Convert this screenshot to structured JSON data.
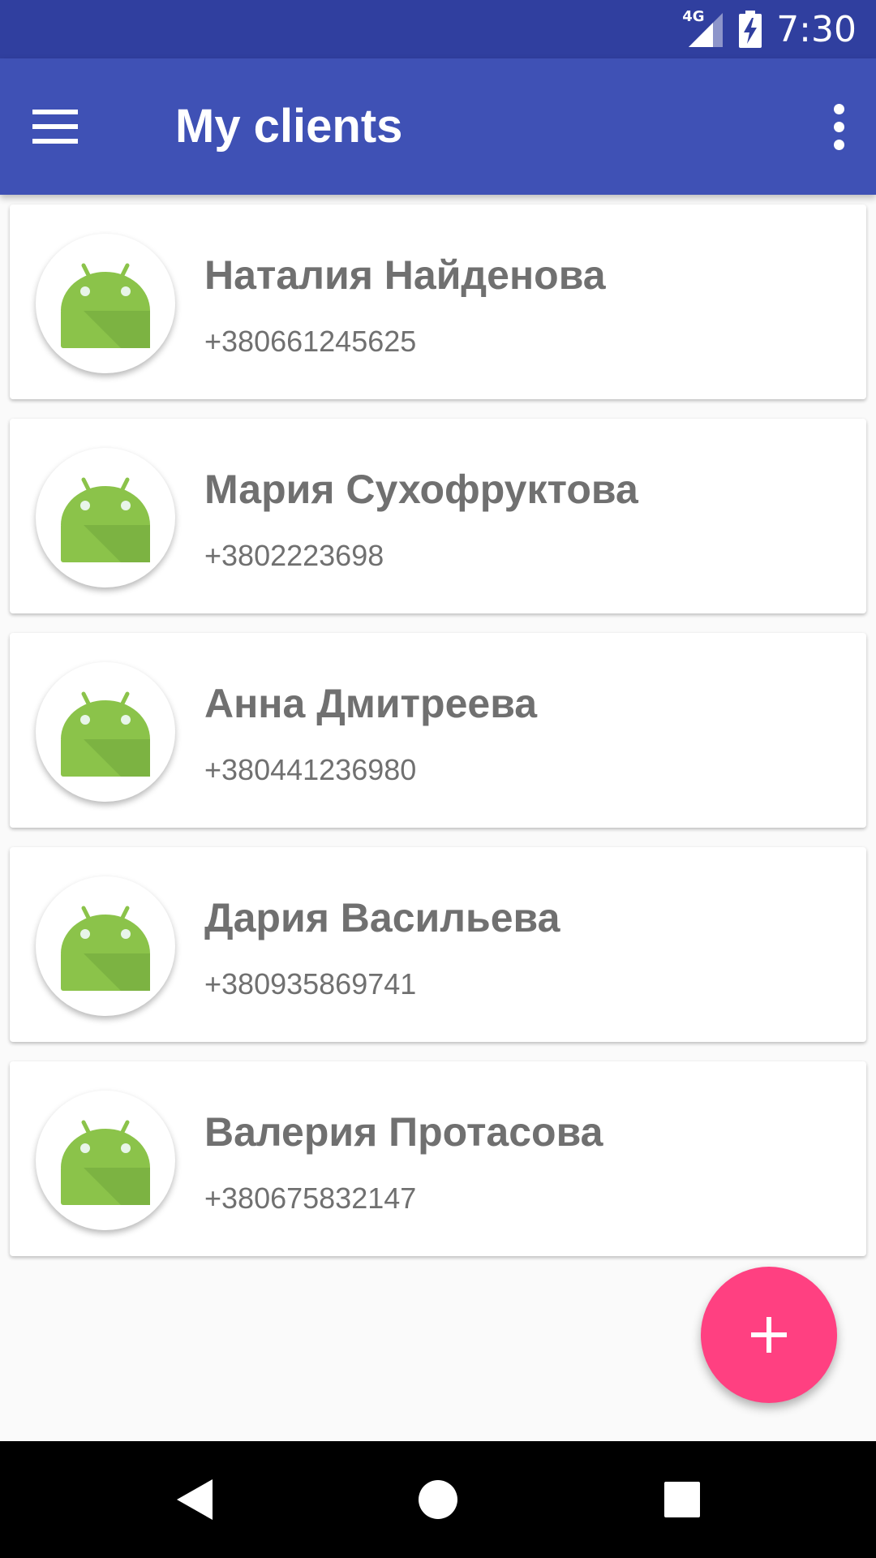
{
  "status_bar": {
    "network_label": "4G",
    "time": "7:30",
    "icons": [
      "signal-icon",
      "battery-charging-icon"
    ]
  },
  "app_bar": {
    "title": "My clients",
    "left_icon": "menu-icon",
    "right_icon": "more-vert-icon"
  },
  "clients": [
    {
      "name": "Наталия Найденова",
      "phone": "+380661245625",
      "avatar_icon": "android-icon"
    },
    {
      "name": "Мария Сухофруктова",
      "phone": "+3802223698",
      "avatar_icon": "android-icon"
    },
    {
      "name": "Анна Дмитреева",
      "phone": "+380441236980",
      "avatar_icon": "android-icon"
    },
    {
      "name": "Дария Васильева",
      "phone": "+380935869741",
      "avatar_icon": "android-icon"
    },
    {
      "name": "Валерия Протасова",
      "phone": "+380675832147",
      "avatar_icon": "android-icon"
    }
  ],
  "fab": {
    "icon": "plus-icon"
  },
  "nav_bar": {
    "icons": [
      "back-icon",
      "home-icon",
      "recents-icon"
    ]
  },
  "colors": {
    "status_bar": "#303f9f",
    "app_bar": "#3f51b5",
    "fab": "#ff4081",
    "text_gray": "#707070",
    "android_green": "#8bc34a",
    "background": "#fafafa"
  }
}
